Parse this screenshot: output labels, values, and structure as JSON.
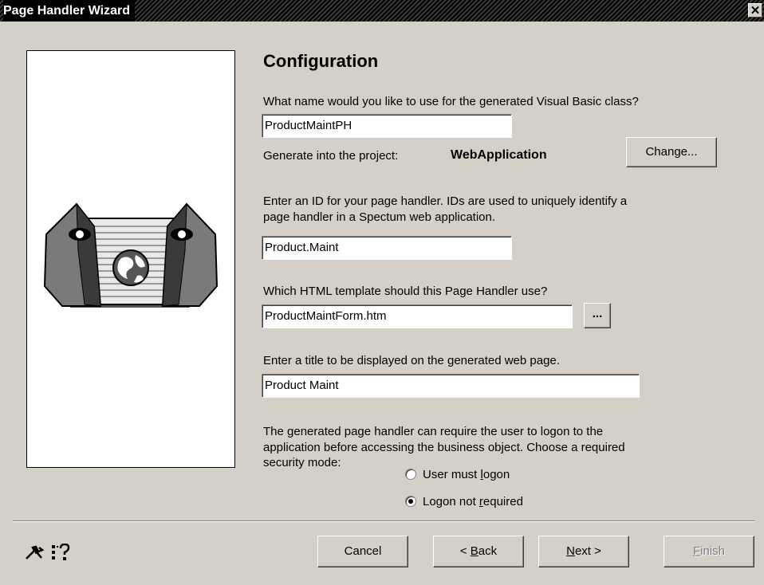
{
  "window": {
    "title": "Page Handler Wizard",
    "close_glyph": "✕"
  },
  "page": {
    "heading": "Configuration",
    "class_question": "What name would you like to use for the generated Visual Basic class?",
    "class_name_value": "ProductMaintPH",
    "project_label": "Generate into the project:",
    "project_name": "WebApplication",
    "change_button": "Change...",
    "id_instructions_line1": "Enter an ID for your page handler. IDs are used to uniquely identify a",
    "id_instructions_line2": "page handler in a Spectum web application.",
    "id_value": "Product.Maint",
    "template_question": "Which HTML template should this Page Handler use?",
    "template_value": "ProductMaintForm.htm",
    "browse_button": "...",
    "title_instructions": "Enter a title to be displayed on the generated web page.",
    "title_value": "Product Maint",
    "security_line1": "The generated page handler can require the user to logon to the",
    "security_line2": "application before accessing the business object. Choose a required",
    "security_line3": "security mode:",
    "radio_options": [
      {
        "before": "User must ",
        "accel": "l",
        "after": "ogon",
        "selected": false
      },
      {
        "before": "Logon not ",
        "accel": "r",
        "after": "equired",
        "selected": true
      }
    ]
  },
  "footer": {
    "cancel": "Cancel",
    "back": {
      "before": "< ",
      "accel": "B",
      "after": "ack"
    },
    "next": {
      "before": "",
      "accel": "N",
      "after": "ext >"
    },
    "finish": {
      "before": "",
      "accel": "F",
      "after": "inish",
      "enabled": false
    },
    "tools_icon": "tools-icon",
    "help_icon": "help-tree-icon"
  }
}
